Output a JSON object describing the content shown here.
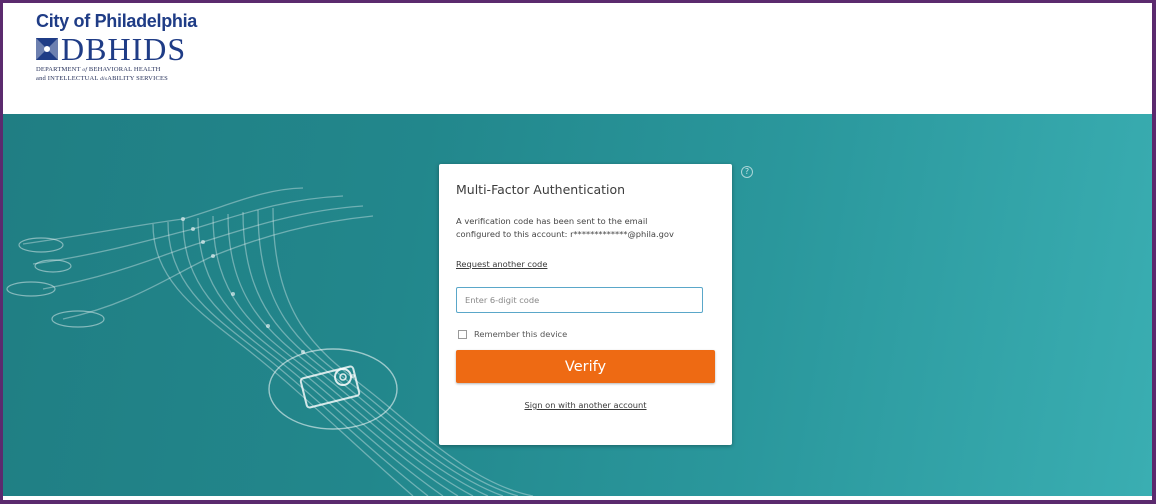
{
  "header": {
    "city": "City of Philadelphia",
    "brand": "DBHIDS",
    "dept_line1_a": "DEPARTMENT ",
    "dept_line1_of": "of",
    "dept_line1_b": " BEHAVIORAL HEALTH",
    "dept_line2_a": "and INTELLECTUAL ",
    "dept_line2_dis": "dis",
    "dept_line2_b": "ABILITY SERVICES"
  },
  "help": {
    "icon": "help-icon",
    "glyph": "?"
  },
  "mfa": {
    "title": "Multi-Factor Authentication",
    "message_line1": "A verification code has been sent to the email",
    "message_line2": "configured to this account: r*************@phila.gov",
    "request_link": "Request another code",
    "code_placeholder": "Enter 6-digit code",
    "code_value": "",
    "remember_label": "Remember this device",
    "remember_checked": false,
    "verify_label": "Verify",
    "signon_link": "Sign on with another account"
  },
  "colors": {
    "brand_blue": "#1f3c86",
    "frame_purple": "#5b2a6e",
    "teal_dark": "#207e83",
    "teal_light": "#3aaeb2",
    "verify_orange": "#ee6a13",
    "input_border": "#5aa7c9"
  }
}
